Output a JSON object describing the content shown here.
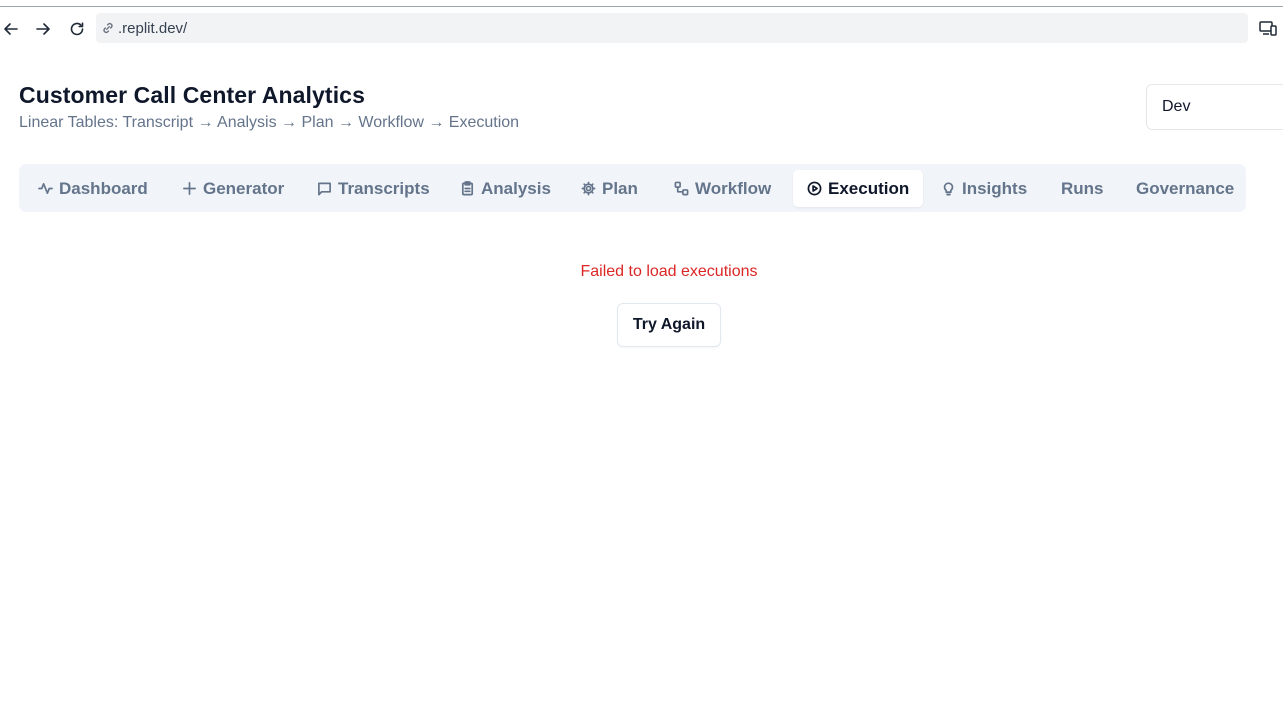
{
  "browser": {
    "url": ".replit.dev/"
  },
  "header": {
    "title": "Customer Call Center Analytics",
    "subtitle": "Linear Tables: Transcript → Analysis → Plan → Workflow → Execution",
    "environment": "Dev"
  },
  "tabs": [
    {
      "label": "Dashboard",
      "icon": "activity-icon",
      "active": false
    },
    {
      "label": "Generator",
      "icon": "plus-icon",
      "active": false
    },
    {
      "label": "Transcripts",
      "icon": "message-square-icon",
      "active": false
    },
    {
      "label": "Analysis",
      "icon": "clipboard-icon",
      "active": false
    },
    {
      "label": "Plan",
      "icon": "gear-icon",
      "active": false
    },
    {
      "label": "Workflow",
      "icon": "workflow-icon",
      "active": false
    },
    {
      "label": "Execution",
      "icon": "play-circle-icon",
      "active": true
    },
    {
      "label": "Insights",
      "icon": "lightbulb-icon",
      "active": false
    },
    {
      "label": "Runs",
      "icon": "",
      "active": false
    },
    {
      "label": "Governance",
      "icon": "",
      "active": false
    }
  ],
  "main": {
    "error_message": "Failed to load executions",
    "retry_label": "Try Again"
  },
  "colors": {
    "error": "#dc2626",
    "tab_bg": "#f1f5f9",
    "muted_text": "#64748b"
  }
}
